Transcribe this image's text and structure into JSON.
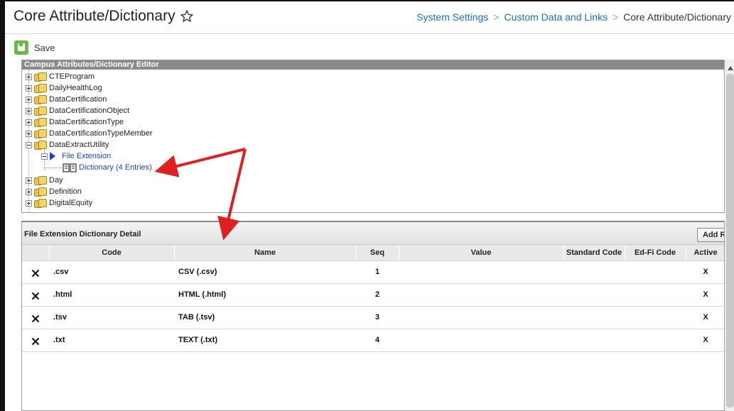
{
  "header": {
    "title": "Core Attribute/Dictionary",
    "breadcrumb": [
      {
        "label": "System Settings"
      },
      {
        "label": "Custom Data and Links"
      },
      {
        "label": "Core Attribute/Dictionary"
      }
    ]
  },
  "toolbar": {
    "save_label": "Save"
  },
  "tree": {
    "header": "Campus Attributes/Dictionary Editor",
    "items": [
      {
        "label": "CTEProgram"
      },
      {
        "label": "DailyHealthLog"
      },
      {
        "label": "DataCertification"
      },
      {
        "label": "DataCertificationObject"
      },
      {
        "label": "DataCertificationType"
      },
      {
        "label": "DataCertificationTypeMember"
      },
      {
        "label": "DataExtractUtility"
      },
      {
        "label": "File Extension"
      },
      {
        "label": "Dictionary (4 Entries)"
      },
      {
        "label": "Day"
      },
      {
        "label": "Definition"
      },
      {
        "label": "DigitalEquity"
      }
    ]
  },
  "detail": {
    "title": "File Extension Dictionary Detail",
    "add_button": "Add R",
    "columns": [
      "",
      "Code",
      "Name",
      "Seq",
      "Value",
      "Standard Code",
      "Ed-Fi Code",
      "Active"
    ],
    "rows": [
      {
        "code": ".csv",
        "name": "CSV (.csv)",
        "seq": "1",
        "value": "",
        "standard_code": "",
        "edfi_code": "",
        "active": "X"
      },
      {
        "code": ".html",
        "name": "HTML (.html)",
        "seq": "2",
        "value": "",
        "standard_code": "",
        "edfi_code": "",
        "active": "X"
      },
      {
        "code": ".tsv",
        "name": "TAB (.tsv)",
        "seq": "3",
        "value": "",
        "standard_code": "",
        "edfi_code": "",
        "active": "X"
      },
      {
        "code": ".txt",
        "name": "TEXT (.txt)",
        "seq": "4",
        "value": "",
        "standard_code": "",
        "edfi_code": "",
        "active": "X"
      }
    ]
  },
  "colors": {
    "link": "#1b6ec2",
    "tree_selected": "#1a3fd9",
    "save_green": "#69b84a",
    "annotation_red": "#e02020"
  },
  "icons": [
    "star-icon",
    "save-icon",
    "folder-icon",
    "arrow-icon",
    "book-icon",
    "delete-x-icon"
  ]
}
